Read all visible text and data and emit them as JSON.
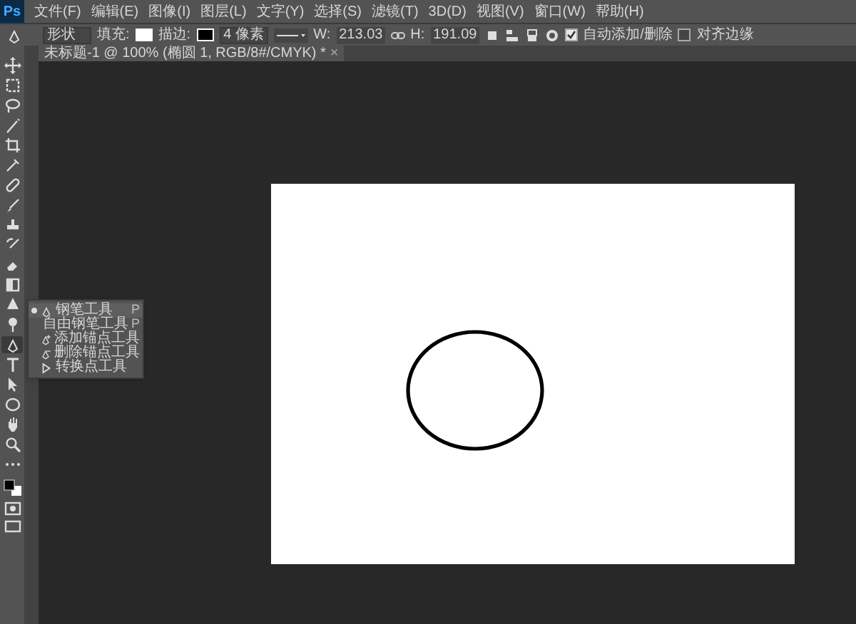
{
  "menu_bar": {
    "logo": "Ps",
    "items": [
      "文件(F)",
      "编辑(E)",
      "图像(I)",
      "图层(L)",
      "文字(Y)",
      "选择(S)",
      "滤镜(T)",
      "3D(D)",
      "视图(V)",
      "窗口(W)",
      "帮助(H)"
    ]
  },
  "options_bar": {
    "mode": "形状",
    "fill_label": "填充:",
    "stroke_label": "描边:",
    "stroke_width": "4 像素",
    "w_label": "W:",
    "w_value": "213.03",
    "h_label": "H:",
    "h_value": "191.09",
    "auto_add_delete": {
      "label": "自动添加/删除",
      "checked": true
    },
    "align_edges": {
      "label": "对齐边缘",
      "checked": false
    }
  },
  "document_tab": {
    "title": "未标题-1 @ 100% (椭圆 1, RGB/8#/CMYK) *",
    "close": "×"
  },
  "toolbar": {
    "tools": [
      {
        "selected": false
      },
      {
        "selected": false
      },
      {
        "selected": false
      },
      {
        "selected": false
      },
      {
        "selected": false
      },
      {
        "selected": false
      },
      {
        "selected": false
      },
      {
        "selected": false
      },
      {
        "selected": false
      },
      {
        "selected": false
      },
      {
        "selected": false
      },
      {
        "selected": false
      },
      {
        "selected": false
      },
      {
        "selected": false
      },
      {
        "selected": true
      },
      {
        "selected": false
      },
      {
        "selected": false
      },
      {
        "selected": false
      },
      {
        "selected": false
      },
      {
        "selected": false
      },
      {
        "selected": false
      }
    ]
  },
  "flyout_menu": [
    {
      "label": "钢笔工具",
      "shortcut": "P",
      "selected": true
    },
    {
      "label": "自由钢笔工具",
      "shortcut": "P",
      "selected": false
    },
    {
      "label": "添加锚点工具",
      "selected": false
    },
    {
      "label": "删除锚点工具",
      "selected": false
    },
    {
      "label": "转换点工具",
      "selected": false
    }
  ]
}
